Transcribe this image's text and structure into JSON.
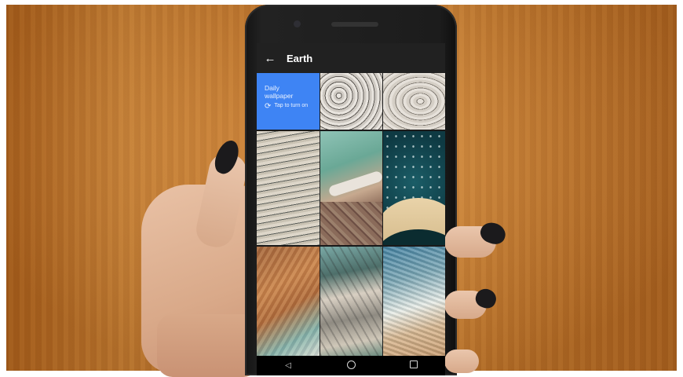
{
  "app_bar": {
    "back_icon": "arrow-left-icon",
    "title": "Earth"
  },
  "daily_tile": {
    "title": "Daily wallpaper",
    "action_icon": "refresh-icon",
    "action_label": "Tap to turn on",
    "color": "#3e84f4"
  },
  "wallpapers": [
    {
      "name": "wallpaper-1"
    },
    {
      "name": "wallpaper-2"
    },
    {
      "name": "wallpaper-3"
    },
    {
      "name": "wallpaper-4"
    },
    {
      "name": "wallpaper-5"
    },
    {
      "name": "wallpaper-6"
    },
    {
      "name": "wallpaper-7"
    },
    {
      "name": "wallpaper-8"
    }
  ],
  "nav": {
    "back_icon": "nav-back-icon",
    "home_icon": "nav-home-icon",
    "recents_icon": "nav-recents-icon"
  },
  "colors": {
    "app_bar": "#212121",
    "accent": "#3e84f4",
    "nail_polish": "#1b1a1c"
  }
}
